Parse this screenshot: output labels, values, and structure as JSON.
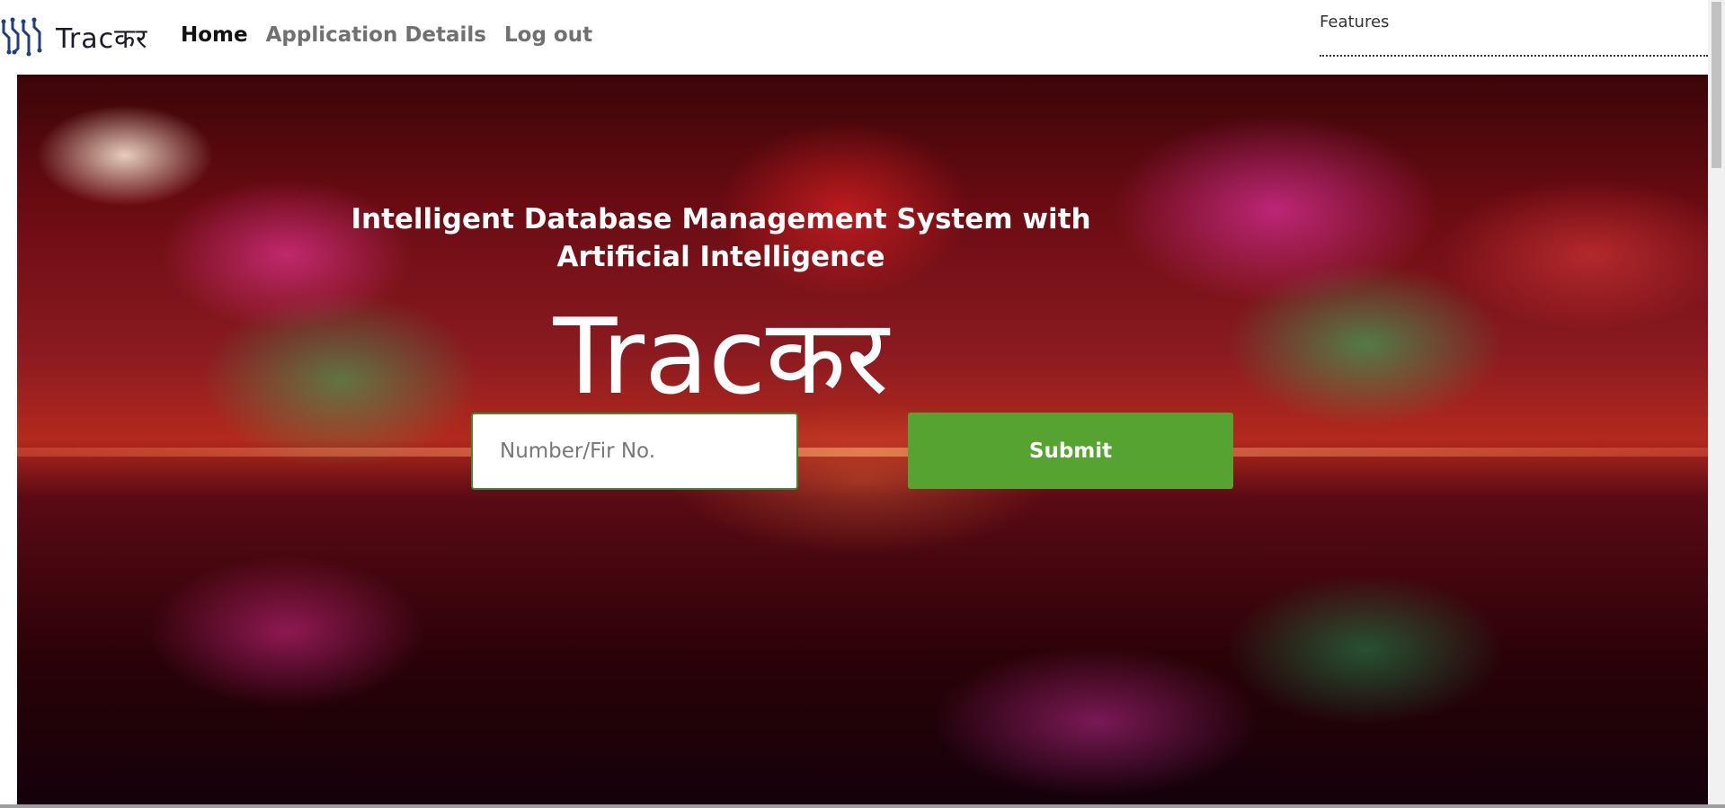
{
  "nav": {
    "brand": "Tracकर",
    "links": [
      {
        "label": "Home",
        "active": true
      },
      {
        "label": "Application Details",
        "active": false
      },
      {
        "label": "Log out",
        "active": false
      }
    ],
    "features_label": "Features"
  },
  "hero": {
    "subtitle": "Intelligent Database Management System with Artificial Intelligence",
    "title": "Tracकर"
  },
  "form": {
    "input_placeholder": "Number/Fir No.",
    "submit_label": "Submit"
  },
  "colors": {
    "submit": "#56a332",
    "input_border": "#3c8a2e",
    "nav_active": "#111111",
    "nav_inactive": "#707070"
  },
  "icons": {
    "brand_logo": "circuit-logo-icon"
  }
}
